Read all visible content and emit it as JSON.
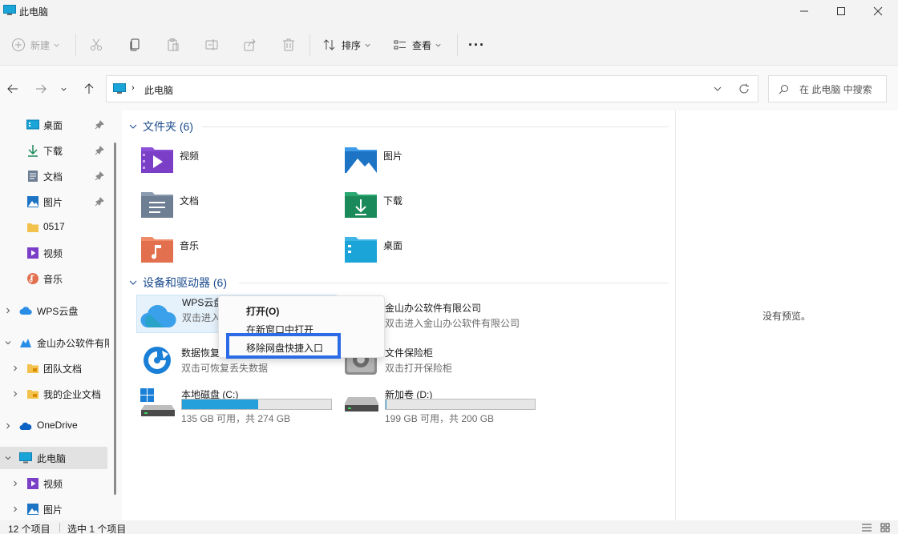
{
  "window": {
    "title": "此电脑",
    "controls": [
      "minimize",
      "maximize",
      "close"
    ]
  },
  "toolbar": {
    "new_label": "新建",
    "sort_label": "排序",
    "view_label": "查看",
    "more_label": "···"
  },
  "address": {
    "crumb": "此电脑",
    "search_placeholder": "在 此电脑 中搜索"
  },
  "sidebar": {
    "items": [
      {
        "label": "桌面",
        "icon": "desktop-icon",
        "pinned": true
      },
      {
        "label": "下载",
        "icon": "download-icon",
        "pinned": true
      },
      {
        "label": "文档",
        "icon": "document-icon",
        "pinned": true
      },
      {
        "label": "图片",
        "icon": "picture-icon",
        "pinned": true
      },
      {
        "label": "0517",
        "icon": "folder-icon"
      },
      {
        "label": "视频",
        "icon": "video-icon"
      },
      {
        "label": "音乐",
        "icon": "music-icon"
      },
      {
        "label": "WPS云盘",
        "icon": "cloud-icon"
      },
      {
        "label": "金山办公软件有限",
        "icon": "wps-icon"
      },
      {
        "label": "团队文档",
        "icon": "team-folder-icon"
      },
      {
        "label": "我的企业文档",
        "icon": "enterprise-folder-icon"
      },
      {
        "label": "OneDrive",
        "icon": "onedrive-icon"
      },
      {
        "label": "此电脑",
        "icon": "pc-icon"
      },
      {
        "label": "视频",
        "icon": "video-icon"
      },
      {
        "label": "图片",
        "icon": "picture-icon"
      }
    ]
  },
  "main": {
    "folders_header": "文件夹 (6)",
    "folders": [
      {
        "name": "视频"
      },
      {
        "name": "图片"
      },
      {
        "name": "文档"
      },
      {
        "name": "下载"
      },
      {
        "name": "音乐"
      },
      {
        "name": "桌面"
      }
    ],
    "devices_header": "设备和驱动器 (6)",
    "devices": [
      {
        "name": "WPS云盘",
        "sub": "双击进入"
      },
      {
        "name": "金山办公软件有限公司",
        "sub": "双击进入金山办公软件有限公司"
      },
      {
        "name": "数据恢复",
        "sub": "双击可恢复丢失数据"
      },
      {
        "name": "文件保险柜",
        "sub": "双击打开保险柜"
      }
    ],
    "drives": [
      {
        "name": "本地磁盘 (C:)",
        "space": "135 GB 可用，共 274 GB",
        "used_fraction": 0.51
      },
      {
        "name": "新加卷 (D:)",
        "space": "199 GB 可用，共 200 GB",
        "used_fraction": 0.005
      }
    ]
  },
  "preview": {
    "text": "没有预览。"
  },
  "context_menu": {
    "open": "打开(O)",
    "open_new_window": "在新窗口中打开",
    "remove_shortcut": "移除网盘快捷入口"
  },
  "status": {
    "item_count": "12 个项目",
    "selected": "选中 1 个项目"
  },
  "colors": {
    "accent": "#2b6be6",
    "drive_fill": "#26a0da",
    "group_header": "#1a4b8c"
  }
}
